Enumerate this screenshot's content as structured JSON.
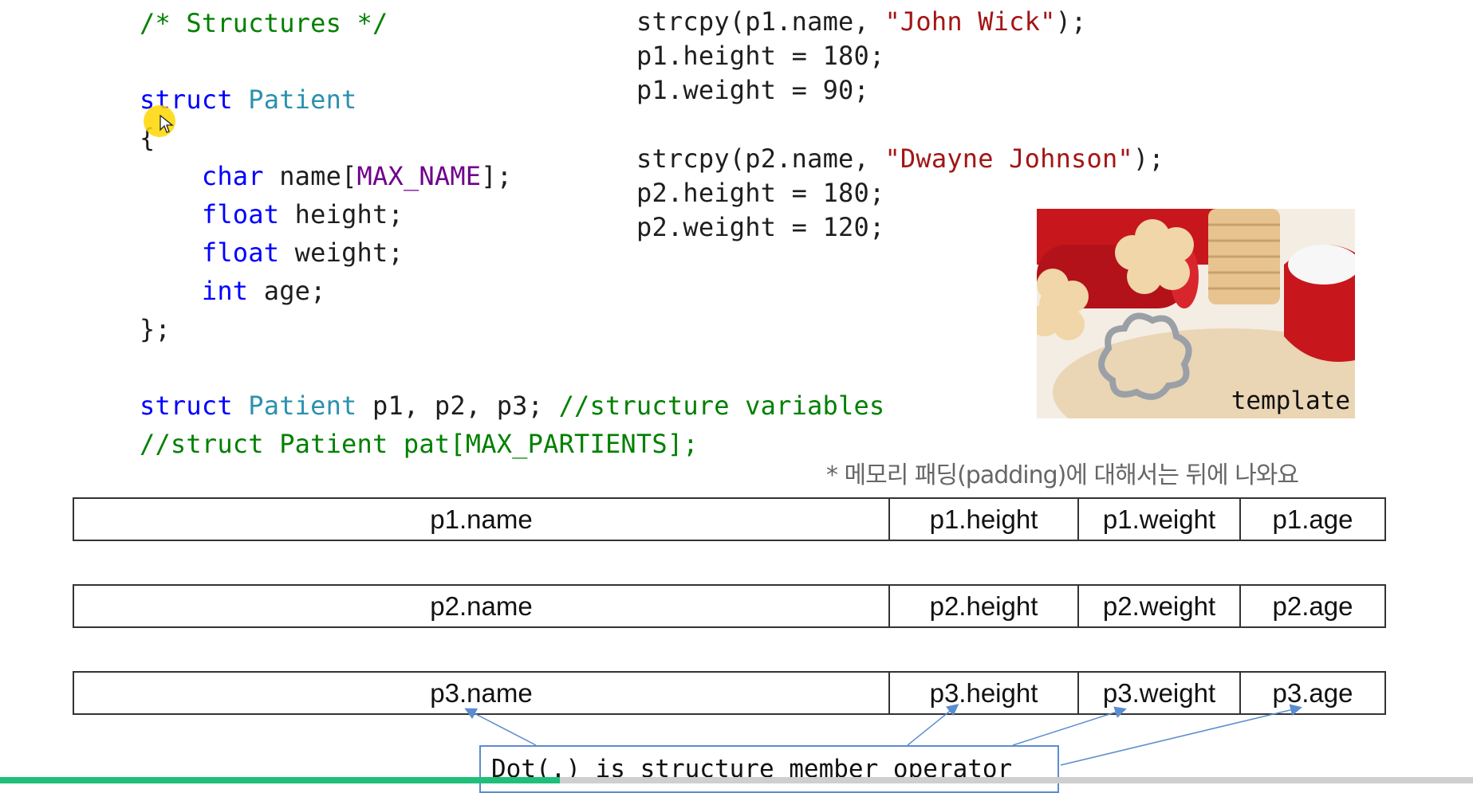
{
  "code_left": {
    "l1": "/* Structures */",
    "l2": {
      "kw": "struct",
      "type": "Patient"
    },
    "l3": "{",
    "l4": {
      "kw": "char",
      "pre": " name[",
      "macro": "MAX_NAME",
      "post": "];"
    },
    "l5": {
      "kw": "float",
      "rest": " height;"
    },
    "l6": {
      "kw": "float",
      "rest": " weight;"
    },
    "l7": {
      "kw": "int",
      "rest": " age;"
    },
    "l8": "};",
    "l10": {
      "kw": "struct",
      "type": "Patient",
      "rest": " p1, p2, p3; ",
      "comment": "//structure variables"
    },
    "l11": "//struct Patient pat[MAX_PARTIENTS];"
  },
  "code_right": {
    "r1": {
      "pre": "strcpy(p1.name, ",
      "str": "\"John Wick\"",
      "post": ");"
    },
    "r2": "p1.height = 180;",
    "r3": "p1.weight = 90;",
    "r5": {
      "pre": "strcpy(p2.name, ",
      "str": "\"Dwayne Johnson\"",
      "post": ");"
    },
    "r6": "p2.height = 180;",
    "r7": "p2.weight = 120;"
  },
  "note": "* 메모리 패딩(padding)에 대해서는 뒤에 나와요",
  "memory": [
    {
      "name": "p1.name",
      "height": "p1.height",
      "weight": "p1.weight",
      "age": "p1.age"
    },
    {
      "name": "p2.name",
      "height": "p2.height",
      "weight": "p2.weight",
      "age": "p2.age"
    },
    {
      "name": "p3.name",
      "height": "p3.height",
      "weight": "p3.weight",
      "age": "p3.age"
    }
  ],
  "photo": {
    "label": "template"
  },
  "callout": "Dot(.) is structure member operator",
  "progress": {
    "fraction": 0.38
  },
  "colors": {
    "keyword": "#0000ff",
    "type": "#2b91af",
    "comment": "#008000",
    "macro": "#6f008a",
    "string": "#a31515",
    "callout_border": "#5b8ccf",
    "progress": "#1fbf7a"
  },
  "icons": [
    "mouse-pointer-icon",
    "cursor-highlight"
  ]
}
